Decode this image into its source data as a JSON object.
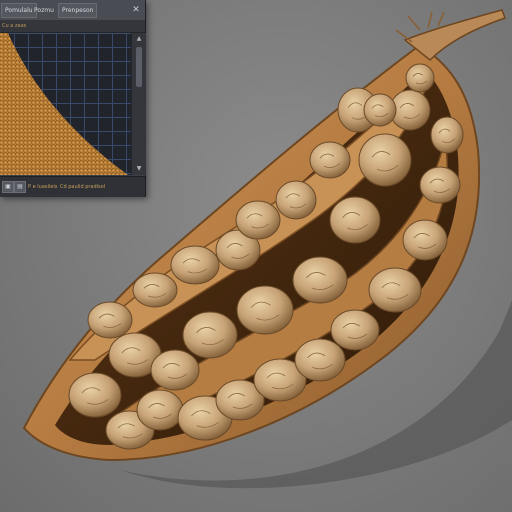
{
  "window": {
    "menu": [
      "Pomulalu",
      "Pozmu",
      "Prenpeson"
    ],
    "close_label": "✕",
    "path_text": "Cu a zaas"
  },
  "statusbar": {
    "icon1": "▣",
    "icon2": "▤",
    "text1": "P e luaslieis",
    "text2": "Cd paulid pradisol"
  },
  "colors": {
    "background": "#7d7d7d",
    "pod_husk": "#b8834a",
    "seed": "#c9a779",
    "panel": "#3d3f46",
    "accent_text": "#c9a15d"
  },
  "icons": [
    "close-icon",
    "scroll-up-icon",
    "scroll-down-icon",
    "frame-icon",
    "grid-icon"
  ]
}
